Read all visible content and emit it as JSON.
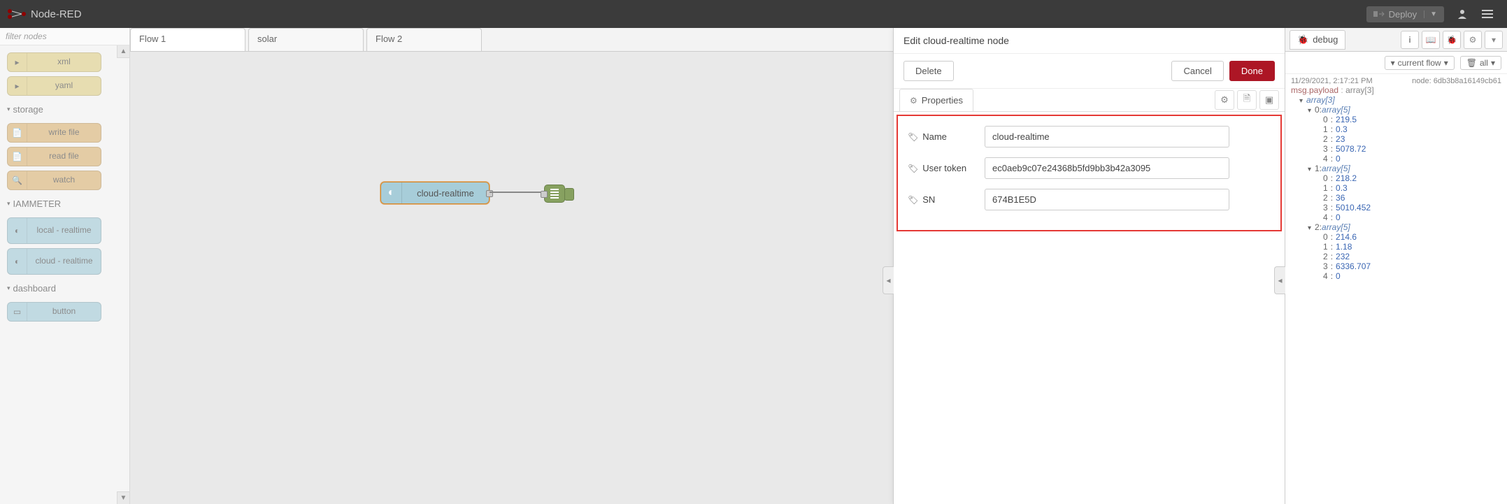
{
  "header": {
    "app_name": "Node-RED",
    "deploy_label": "Deploy"
  },
  "palette": {
    "filter_placeholder": "filter nodes",
    "top_nodes": [
      {
        "label": "xml"
      },
      {
        "label": "yaml"
      }
    ],
    "categories": [
      {
        "name": "storage",
        "nodes": [
          {
            "label": "write file"
          },
          {
            "label": "read file"
          },
          {
            "label": "watch"
          }
        ]
      },
      {
        "name": "IAMMETER",
        "nodes": [
          {
            "label": "local - realtime"
          },
          {
            "label": "cloud - realtime"
          }
        ]
      },
      {
        "name": "dashboard",
        "nodes": [
          {
            "label": "button"
          }
        ]
      }
    ]
  },
  "workspace": {
    "tabs": [
      {
        "label": "Flow 1",
        "active": true
      },
      {
        "label": "solar",
        "active": false
      },
      {
        "label": "Flow 2",
        "active": false
      }
    ],
    "flow_node_label": "cloud-realtime"
  },
  "edit_tray": {
    "title": "Edit cloud-realtime node",
    "delete_label": "Delete",
    "cancel_label": "Cancel",
    "done_label": "Done",
    "properties_label": "Properties",
    "fields": {
      "name_label": "Name",
      "name_value": "cloud-realtime",
      "token_label": "User token",
      "token_value": "ec0aeb9c07e24368b5fd9bb3b42a3095",
      "sn_label": "SN",
      "sn_value": "674B1E5D"
    }
  },
  "sidebar": {
    "tab_label": "debug",
    "filter_label": "current flow",
    "clear_label": "all",
    "message": {
      "timestamp": "11/29/2021, 2:17:21 PM",
      "node_id": "node: 6db3b8a16149cb61",
      "topic_key": "msg.payload",
      "topic_type": "array[3]",
      "root_label": "array[3]",
      "items": [
        {
          "label": "array[5]",
          "values": [
            219.5,
            0.3,
            23,
            5078.72,
            0
          ]
        },
        {
          "label": "array[5]",
          "values": [
            218.2,
            0.3,
            36,
            5010.452,
            0
          ]
        },
        {
          "label": "array[5]",
          "values": [
            214.6,
            1.18,
            232,
            6336.707,
            0
          ]
        }
      ]
    }
  }
}
